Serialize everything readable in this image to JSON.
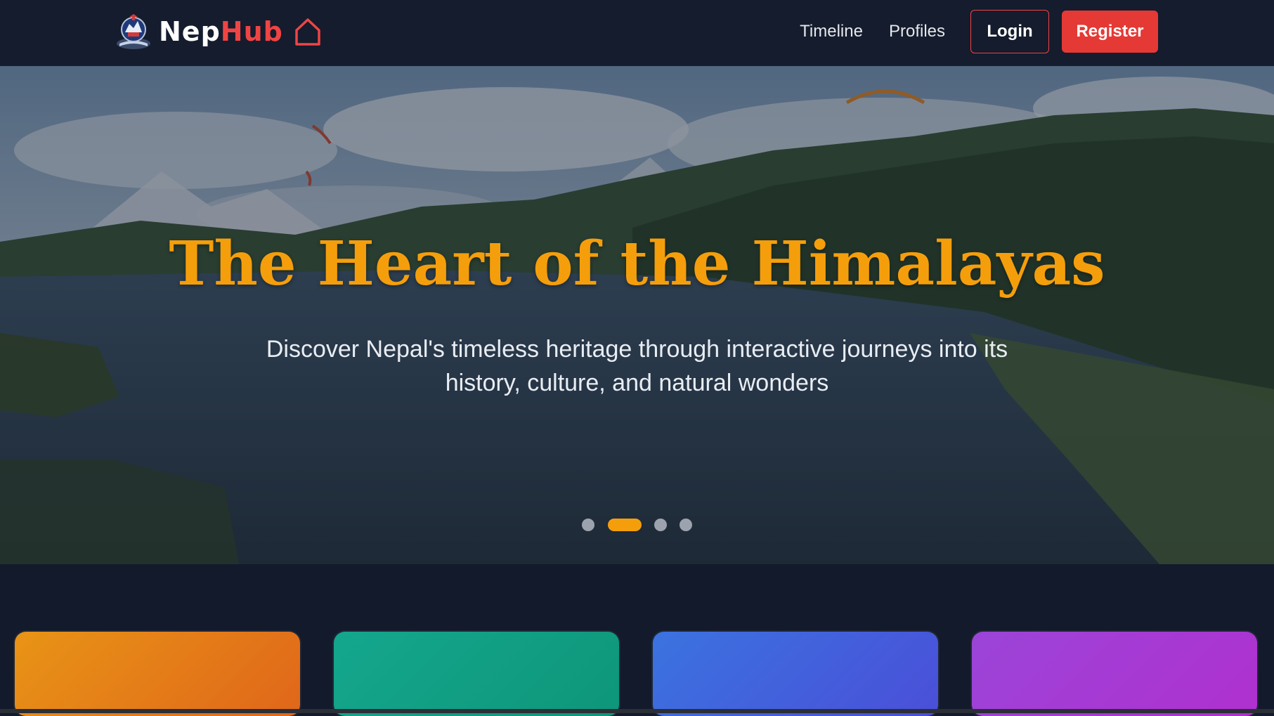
{
  "brand": {
    "name_part1": "Nep",
    "name_part2": "Hub",
    "emblem_icon": "nepal-emblem-icon",
    "home_icon": "home-icon"
  },
  "nav": {
    "links": [
      "Timeline",
      "Profiles"
    ],
    "login_label": "Login",
    "register_label": "Register"
  },
  "hero": {
    "title": "The Heart of the Himalayas",
    "subtitle": "Discover Nepal's timeless heritage through interactive journeys into its history, culture, and natural wonders",
    "slides_count": 4,
    "active_slide": 2
  },
  "feature_cards": [
    {
      "color_start": "#e89416",
      "color_end": "#e0661a"
    },
    {
      "color_start": "#14a78e",
      "color_end": "#0e9679"
    },
    {
      "color_start": "#3b73e0",
      "color_end": "#4a4fd8"
    },
    {
      "color_start": "#9b45d8",
      "color_end": "#b030cf"
    }
  ],
  "colors": {
    "nav_bg": "#141c2d",
    "page_bg": "#121a2b",
    "accent_red": "#e53935",
    "accent_gold": "#f59e0b"
  }
}
